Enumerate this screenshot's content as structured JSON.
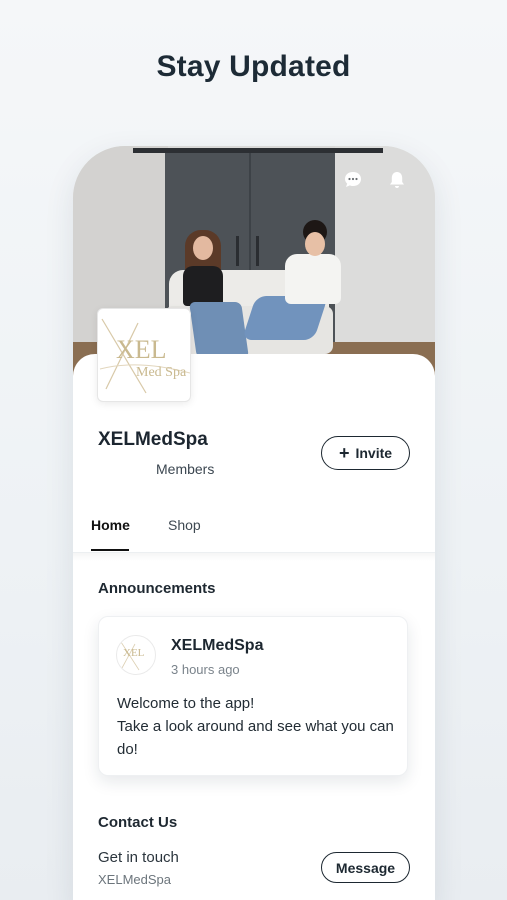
{
  "headline": "Stay Updated",
  "header": {
    "icons": [
      "chat-icon",
      "bell-icon"
    ]
  },
  "logo": {
    "text_line1": "XEL",
    "text_line2": "Med Spa"
  },
  "profile": {
    "site_name": "XELMedSpa",
    "members_label": "Members",
    "invite_label": "Invite",
    "invite_icon": "plus-icon"
  },
  "tabs": [
    {
      "label": "Home",
      "active": true
    },
    {
      "label": "Shop",
      "active": false
    }
  ],
  "announcements": {
    "title": "Announcements",
    "post": {
      "author": "XELMedSpa",
      "time": "3 hours ago",
      "line1": "Welcome to the app!",
      "line2": "Take a look around and see what you can do!"
    }
  },
  "contact": {
    "title": "Contact Us",
    "line": "Get in touch",
    "sub": "XELMedSpa",
    "button_label": "Message"
  },
  "colors": {
    "text_dark": "#1d2831",
    "accent_gold": "#c8b07a",
    "background": "#eef2f5"
  }
}
